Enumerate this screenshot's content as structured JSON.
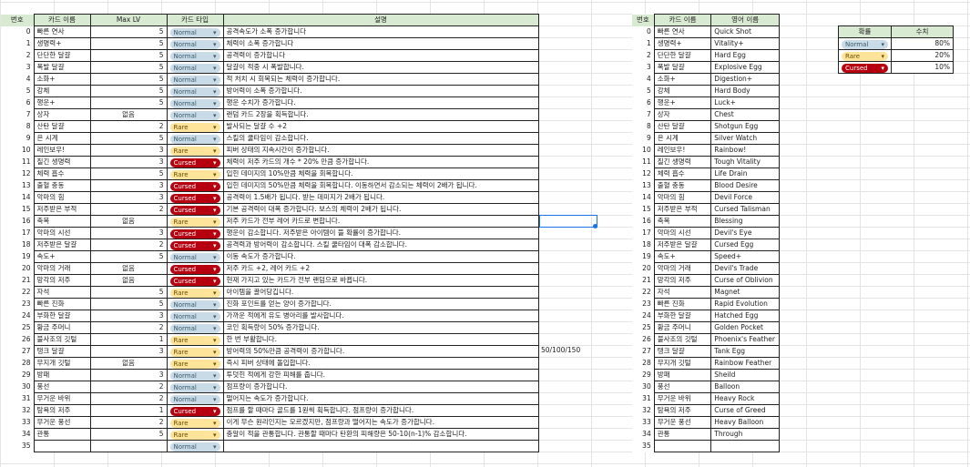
{
  "main": {
    "headers": [
      "번호",
      "카드 이름",
      "Max LV",
      "카드 타입",
      "설명"
    ],
    "rows": [
      [
        "0",
        "빠른 연사",
        "5",
        "Normal",
        "공격속도가 소폭 증가합니다"
      ],
      [
        "1",
        "생명력+",
        "5",
        "Normal",
        "체력이 소폭 증가합니다"
      ],
      [
        "2",
        "단단한 달걀",
        "5",
        "Normal",
        "공격력이 증가합니다"
      ],
      [
        "3",
        "폭발 달걀",
        "5",
        "Normal",
        "달걀이 적중 시 폭발합니다."
      ],
      [
        "4",
        "소화+",
        "5",
        "Normal",
        "적 처치 시 회복되는 체력이 증가합니다."
      ],
      [
        "5",
        "강체",
        "5",
        "Normal",
        "방어력이 소폭 증가합니다."
      ],
      [
        "6",
        "행운+",
        "5",
        "Normal",
        "행운 수치가 증가합니다."
      ],
      [
        "7",
        "상자",
        "없음",
        "Normal",
        "랜덤 카드 2장을 획득합니다."
      ],
      [
        "8",
        "산탄 달걀",
        "2",
        "Rare",
        "발사되는 달걀 수 +2"
      ],
      [
        "9",
        "은 시계",
        "5",
        "Normal",
        "스킬의 쿨타임이 감소합니다."
      ],
      [
        "10",
        "레인보우!",
        "3",
        "Rare",
        "피버 상태의 지속시간이 증가합니다."
      ],
      [
        "11",
        "질긴 생명력",
        "3",
        "Cursed",
        "체력이 저주 카드의 개수 * 20% 만큼 증가합니다."
      ],
      [
        "12",
        "체력 흡수",
        "5",
        "Rare",
        "입힌 데미지의 10%만큼 체력을 회복합니다."
      ],
      [
        "13",
        "출혈 충동",
        "3",
        "Cursed",
        "입힌 데미지의 50%만큼 체력을 회복합니다. 이동하면서 감소되는 체력이 2배가 됩니다."
      ],
      [
        "14",
        "악마의 힘",
        "3",
        "Cursed",
        "공격력이 1.5배가 됩니다. 받는 데미지가 2배가 됩니다."
      ],
      [
        "15",
        "저주받은 부적",
        "2",
        "Cursed",
        "기본 공격력이 대폭 증가합니다. 보스의 체력이 2배가 됩니다."
      ],
      [
        "16",
        "축복",
        "없음",
        "Rare",
        "저주 카드가 전부 레어 카드로 변합니다."
      ],
      [
        "17",
        "악마의 시선",
        "3",
        "Cursed",
        "행운이 감소합니다. 저주받은 아이템이 뜰 확률이 증가합니다."
      ],
      [
        "18",
        "저주받은 달걀",
        "2",
        "Cursed",
        "공격력과 방어력이 감소합니다. 스킬 쿨타임이 대폭 감소합니다."
      ],
      [
        "19",
        "속도+",
        "5",
        "Normal",
        "이동 속도가 증가합니다."
      ],
      [
        "20",
        "악마의 거래",
        "없음",
        "Cursed",
        "저주 카드 +2, 레어 카드 +2"
      ],
      [
        "21",
        "망각의 저주",
        "없음",
        "Cursed",
        "현재 가지고 있는 카드가 전부 랜덤으로 바뀝니다."
      ],
      [
        "22",
        "자석",
        "5",
        "Rare",
        "아이템을 끌어당깁니다."
      ],
      [
        "23",
        "빠른 진화",
        "5",
        "Normal",
        "진화 포인트를 얻는 양이 증가합니다."
      ],
      [
        "24",
        "부화한 달걀",
        "3",
        "Normal",
        "가까운 적에게 유도 병아리를 발사합니다."
      ],
      [
        "25",
        "황금 주머니",
        "2",
        "Normal",
        "코인 획득량이 50% 증가합니다."
      ],
      [
        "26",
        "불사조의 깃털",
        "1",
        "Rare",
        "한 번 부활합니다."
      ],
      [
        "27",
        "탱크 달걀",
        "3",
        "Rare",
        "방어력의 50%만큼 공격력이 증가합니다."
      ],
      [
        "28",
        "무지개 깃털",
        "없음",
        "Rare",
        "즉시 피버 상태에 돌입합니다."
      ],
      [
        "29",
        "방패",
        "3",
        "Normal",
        "투덧힌 적에게 강한 피해를 줍니다."
      ],
      [
        "30",
        "풍선",
        "2",
        "Normal",
        "점프량이 증가합니다."
      ],
      [
        "31",
        "무거운 바위",
        "2",
        "Normal",
        "떨어지는 속도가 증가합니다."
      ],
      [
        "32",
        "탐욕의 저주",
        "1",
        "Cursed",
        "점프를 할 때마다 골드를 1원씩 획득합니다. 점프량이 증가합니다."
      ],
      [
        "33",
        "무거운 풍선",
        "2",
        "Rare",
        "이게 무슨 원리인지는 모르겠지만, 점프량과 떨어지는 속도가 증가합니다."
      ],
      [
        "34",
        "관통",
        "5",
        "Rare",
        "충알이 적을 관통합니다. 관통할 때마다 탄환의 피해량은 50-10(n-1)% 감소합니다."
      ],
      [
        "35",
        "",
        "",
        "Normal",
        ""
      ]
    ]
  },
  "eng": {
    "headers": [
      "번호",
      "카드 이름",
      "영어 이름"
    ],
    "rows": [
      [
        "0",
        "빠른 연사",
        "Quick Shot"
      ],
      [
        "1",
        "생명력+",
        "Vitality+"
      ],
      [
        "2",
        "단단한 달걀",
        "Hard Egg"
      ],
      [
        "3",
        "폭발 달걀",
        "Explosive Egg"
      ],
      [
        "4",
        "소화+",
        "Digestion+"
      ],
      [
        "5",
        "강체",
        "Hard Body"
      ],
      [
        "6",
        "행운+",
        "Luck+"
      ],
      [
        "7",
        "상자",
        "Chest"
      ],
      [
        "8",
        "산탄 달걀",
        "Shotgun Egg"
      ],
      [
        "9",
        "은 시계",
        "Silver Watch"
      ],
      [
        "10",
        "레인보우!",
        "Rainbow!"
      ],
      [
        "11",
        "질긴 생명력",
        "Tough Vitality"
      ],
      [
        "12",
        "체력 흡수",
        "Life Drain"
      ],
      [
        "13",
        "출혈 충동",
        "Blood Desire"
      ],
      [
        "14",
        "악마의 힘",
        "Devil Force"
      ],
      [
        "15",
        "저주받은 부적",
        "Cursed Talisman"
      ],
      [
        "16",
        "축복",
        "Blessing"
      ],
      [
        "17",
        "악마의 시선",
        "Devil's Eye"
      ],
      [
        "18",
        "저주받은 달걀",
        "Cursed Egg"
      ],
      [
        "19",
        "속도+",
        "Speed+"
      ],
      [
        "20",
        "악마의 거래",
        "Devil's Trade"
      ],
      [
        "21",
        "망각의 저주",
        "Curse of Oblivion"
      ],
      [
        "22",
        "자석",
        "Magnet"
      ],
      [
        "23",
        "빠른 진화",
        "Rapid Evolution"
      ],
      [
        "24",
        "부화한 달걀",
        "Hatched Egg"
      ],
      [
        "25",
        "황금 주머니",
        "Golden Pocket"
      ],
      [
        "26",
        "불사조의 깃털",
        "Phoenix's Feather"
      ],
      [
        "27",
        "탱크 달걀",
        "Tank Egg"
      ],
      [
        "28",
        "무지개 깃털",
        "Rainbow Feather"
      ],
      [
        "29",
        "방패",
        "Sheild"
      ],
      [
        "30",
        "풍선",
        "Balloon"
      ],
      [
        "31",
        "무거운 바위",
        "Heavy Rock"
      ],
      [
        "32",
        "탐욕의 저주",
        "Curse of Greed"
      ],
      [
        "33",
        "무거운 풍선",
        "Heavy Balloon"
      ],
      [
        "34",
        "관통",
        "Through"
      ],
      [
        "35",
        "",
        ""
      ]
    ]
  },
  "prob": {
    "headers": [
      "확률",
      "수치"
    ],
    "rows": [
      [
        "Normal",
        "80%"
      ],
      [
        "Rare",
        "20%"
      ],
      [
        "Cursed",
        "10%"
      ]
    ]
  },
  "stray_value": "50/100/150"
}
